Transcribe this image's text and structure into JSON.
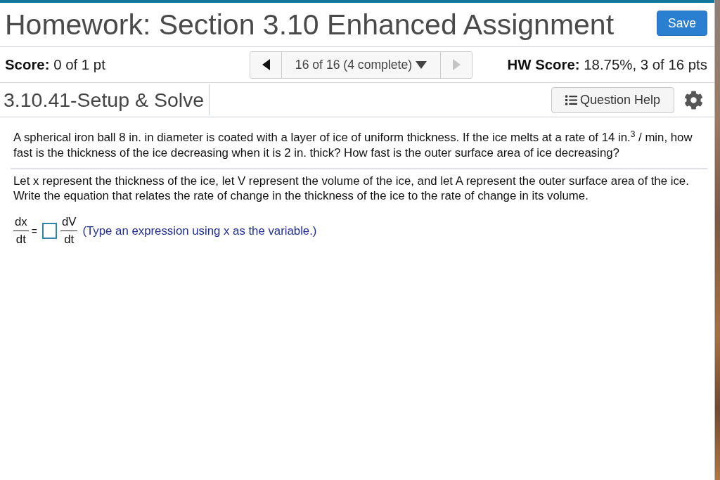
{
  "header": {
    "title": "Homework: Section 3.10 Enhanced Assignment",
    "save_button": {
      "label": "Save"
    }
  },
  "score_bar": {
    "score": "**Score:** 0 of 1 pt",
    "navigator": {
      "previous": {
        "disabled": false
      },
      "position": "16 of 16 (4 complete)",
      "next": {
        "disabled": true
      }
    },
    "hw_score": "**HW Score:** 18.75%, 3 of 16 pts"
  },
  "question_bar": {
    "title": "3.10.41-Setup & Solve",
    "help_button": {
      "label": "Question Help"
    }
  },
  "problem": {
    "statement": "A spherical iron ball 8 in. in diameter is coated with a layer of ice of uniform thickness. If the ice melts at a rate of 14 in.$^{3}$ / min, how fast is the thickness of the ice decreasing when it is 2 in. thick? How fast is the outer surface area of ice decreasing?",
    "instructions": [
      "Let x represent the thickness of the ice, let V represent the volume of the ice, and let A represent the outer surface area of the ice.",
      "Write the equation that relates the rate of change in the thickness of the ice to the rate of change in its volume."
    ]
  },
  "answer": {
    "lhs": {
      "numerator": "dx",
      "denominator": "dt"
    },
    "equals": "=",
    "rhs": {
      "numerator": "dV",
      "denominator": "dt"
    },
    "hint": "(Type an expression using x as the variable.)"
  }
}
